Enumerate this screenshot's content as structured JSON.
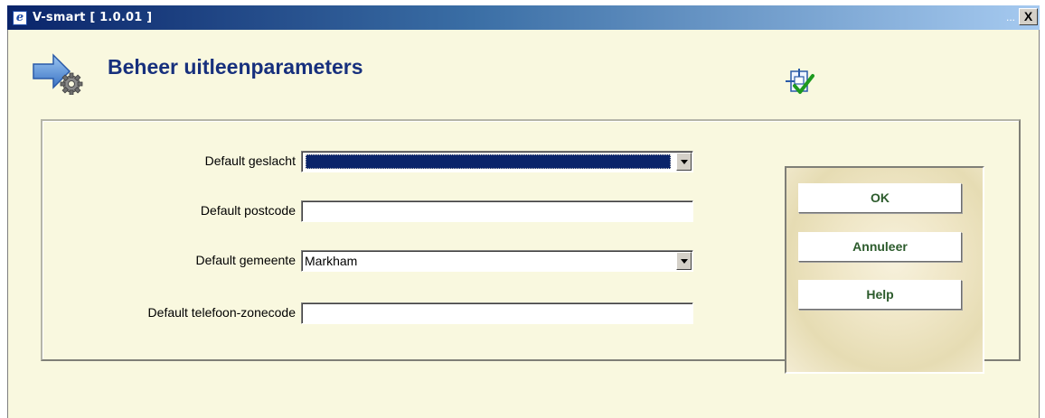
{
  "window": {
    "title": "V-smart [ 1.0.01 ]",
    "dots": "...",
    "close_label": "X"
  },
  "page": {
    "title": "Beheer uitleenparameters",
    "header_icon": "gear-arrow-icon",
    "corner_icon": "save-checkmark-icon"
  },
  "form": {
    "rows": [
      {
        "label": "Default geslacht",
        "type": "select",
        "value": ""
      },
      {
        "label": "Default postcode",
        "type": "text",
        "value": ""
      },
      {
        "label": "Default gemeente",
        "type": "select",
        "value": "Markham"
      },
      {
        "label": "Default telefoon-zonecode",
        "type": "text",
        "value": ""
      }
    ]
  },
  "buttons": {
    "ok": "OK",
    "cancel": "Annuleer",
    "help": "Help"
  },
  "colors": {
    "background": "#f9f8df",
    "title_text": "#17307d",
    "button_text": "#2c5b2c",
    "select_highlight": "#0a246a"
  }
}
